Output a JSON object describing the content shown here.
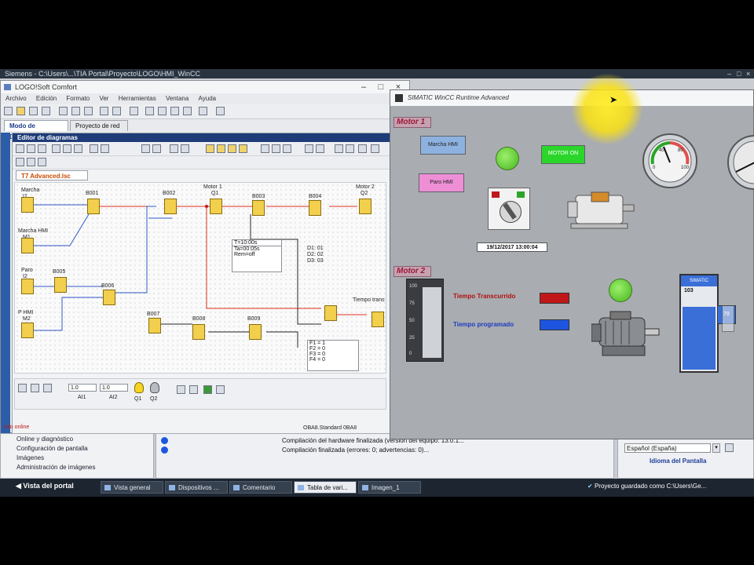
{
  "tia": {
    "title": "Siemens - C:\\Users\\...\\TIA Portal\\Proyecto\\LOGO\\HMI_WinCC",
    "controls": [
      "–",
      "□",
      "×"
    ]
  },
  "logo_window": {
    "title": "LOGO!Soft Comfort",
    "menu": [
      "Archivo",
      "Edición",
      "Formato",
      "Ver",
      "Herramientas",
      "Ventana",
      "Ayuda"
    ],
    "tabs": [
      "Modo de Diagrama",
      "Proyecto de red"
    ],
    "editor_title": "Editor de diagramas",
    "diagram_tab": "T7 Advanced.lsc",
    "labels": {
      "marcha": "Marcha",
      "i1": "I1",
      "marcha_hmi": "Marcha HMI",
      "m1": "M1",
      "paro": "Paro",
      "i2": "I2",
      "paro_hmi": "P HMI",
      "m2": "M2",
      "motor1": "Motor 1",
      "q1": "Q1",
      "motor2": "Motor 2",
      "q2": "Q2",
      "tiempo": "Tiempo trans",
      "b001": "B001",
      "b002": "B002",
      "b003": "B003",
      "b004": "B004",
      "b005": "B005",
      "b006": "B006",
      "b007": "B007",
      "b008": "B008",
      "b009": "B009"
    },
    "param_table": {
      "header": "T=10:00s",
      "rows": [
        "Ta=00:05s",
        "Rem=off",
        "D1: 01",
        "D2: 02",
        "D3: 03"
      ]
    },
    "io_table": [
      "F1 = 1",
      "F2 = 0",
      "F3 = 0",
      "F4 = 0"
    ],
    "sim": {
      "field1": "1.0",
      "field2": "1.0",
      "lbl1": "AI1",
      "lbl2": "AI2",
      "q1": "Q1",
      "q2": "Q2"
    },
    "status": "OBA8.Standard 0BA8"
  },
  "props_pane": {
    "items": [
      "Online y diagnóstico",
      "Configuración de pantalla",
      "Imágenes",
      "Administración de imágenes"
    ],
    "error_label": "Info online"
  },
  "info_pane": {
    "messages": [
      "Compilación del hardware finalizada (versión del equipo: 13.0.1...",
      "Compilación finalizada (errores: 0; advertencias: 0)..."
    ]
  },
  "lang_pane": {
    "label": "Idioma de edición",
    "value": "Español (España)",
    "footer": "Idioma del Pantalla"
  },
  "taskbar": {
    "portal_view": "Vista del portal",
    "items": [
      "Vista general",
      "Dispositivos ...",
      "Comentario",
      "Tabla de vari...",
      "Imagen_1"
    ],
    "active_index": 3,
    "status": "Proyecto guardado como C:\\Users\\Ge..."
  },
  "wincc": {
    "title": "SIMATIC WinCC Runtime Advanced",
    "motor1_label": "Motor 1",
    "motor2_label": "Motor 2",
    "btn_marcha": "Marcha HMI",
    "btn_paro": "Paro HMI",
    "btn_motor": "MOTOR ON",
    "datetime": "19/12/2017 13:00:04",
    "tiempo_transcurrido": "Tiempo Transcurrido",
    "tiempo_programado": "Tiempo programado",
    "gauge_values": [
      "0",
      "40",
      "80",
      "100"
    ],
    "tank_label": "SIMATIC",
    "tank_value": "103",
    "tank_readout": "70",
    "bar_scale": [
      "100",
      "75",
      "50",
      "25",
      "0"
    ],
    "colors": {
      "lamp": "#45b51f",
      "red_field": "#c01818",
      "blue_field": "#1e55e0",
      "motor_label": "#a0173a"
    }
  }
}
